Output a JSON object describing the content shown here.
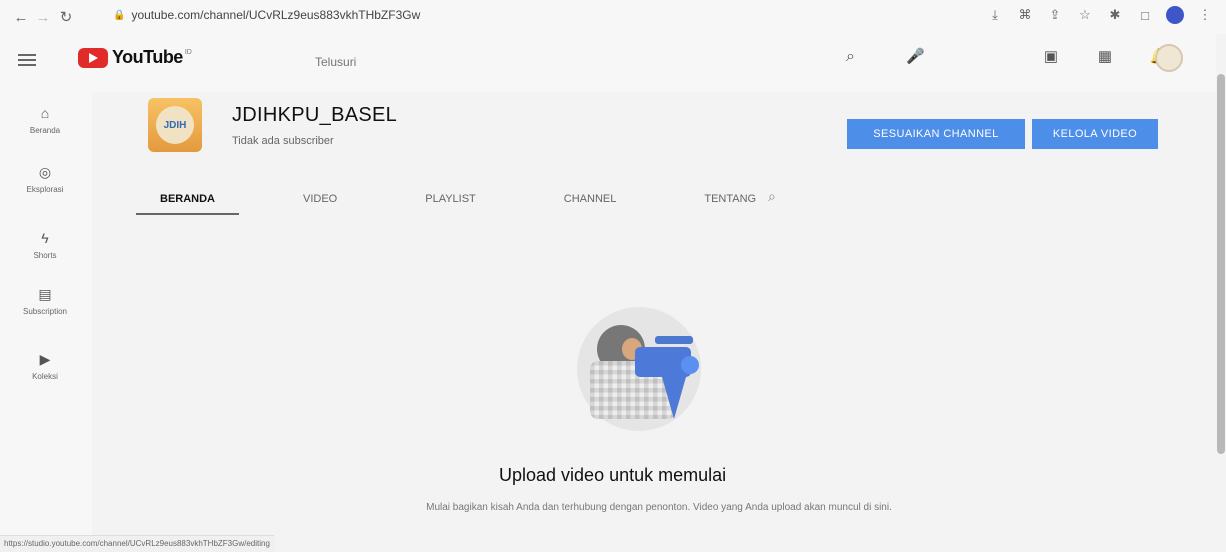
{
  "browser": {
    "url": "youtube.com/channel/UCvRLz9eus883vkhTHbZF3Gw",
    "status_url": "https://studio.youtube.com/channel/UCvRLz9eus883vkhTHbZF3Gw/editing"
  },
  "youtube": {
    "logo_text": "YouTube",
    "logo_sup": "ID",
    "search_placeholder": "Telusuri"
  },
  "sidebar": {
    "items": [
      {
        "label": "Beranda",
        "icon": "home-icon"
      },
      {
        "label": "Eksplorasi",
        "icon": "explore-icon"
      },
      {
        "label": "Shorts",
        "icon": "shorts-icon"
      },
      {
        "label": "Subscription",
        "icon": "subscriptions-icon"
      },
      {
        "label": "Koleksi",
        "icon": "library-icon"
      }
    ]
  },
  "channel": {
    "name": "JDIHKPU_BASEL",
    "subscribers": "Tidak ada subscriber",
    "avatar_text": "JDIH"
  },
  "actions": {
    "customize": "SESUAIKAN CHANNEL",
    "manage": "KELOLA VIDEO"
  },
  "tabs": [
    {
      "label": "BERANDA",
      "active": true
    },
    {
      "label": "VIDEO",
      "active": false
    },
    {
      "label": "PLAYLIST",
      "active": false
    },
    {
      "label": "CHANNEL",
      "active": false
    },
    {
      "label": "TENTANG",
      "active": false
    }
  ],
  "empty_state": {
    "title": "Upload video untuk memulai",
    "description": "Mulai bagikan kisah Anda dan terhubung dengan penonton. Video yang Anda upload akan muncul di sini."
  },
  "colors": {
    "accent": "#4c8ee8",
    "youtube_red": "#e12b2b",
    "page_bg": "#f3f3f3"
  }
}
